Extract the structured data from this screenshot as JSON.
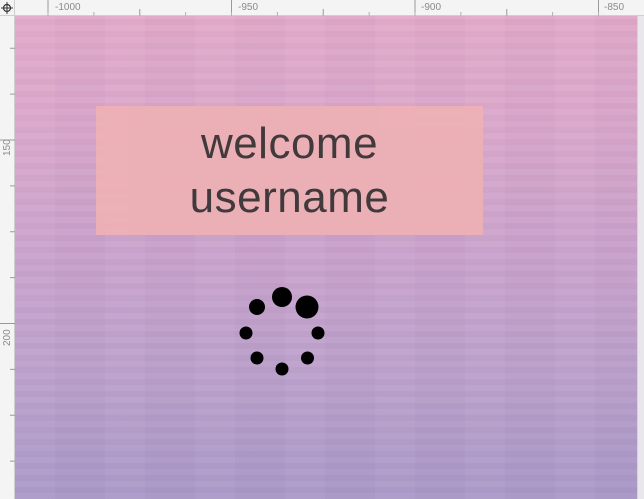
{
  "rulers": {
    "top_labels": [
      "-1000",
      "-950",
      "-900",
      "-850"
    ],
    "left_labels": [
      "150",
      "200"
    ]
  },
  "banner": {
    "line1": "welcome",
    "line2": "username",
    "background": "#edb0b5",
    "text_color": "#3a3535"
  },
  "canvas": {
    "gradient_top": "#e2a9c9",
    "gradient_bottom": "#aa98c8"
  },
  "spinner": {
    "icon": "loading-spinner-icon",
    "dot_count": 8,
    "color": "#000000"
  }
}
